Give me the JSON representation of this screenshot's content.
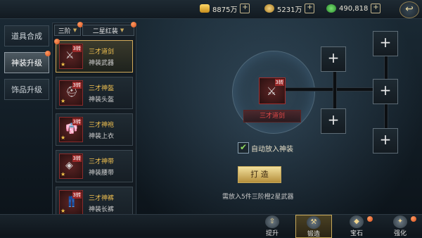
{
  "resources": {
    "gold": {
      "value": "8875万",
      "plus": "+"
    },
    "silver": {
      "value": "5231万",
      "plus": "+"
    },
    "jade": {
      "value": "490,818",
      "plus": "+"
    }
  },
  "back_button_label": "↩",
  "left_nav": [
    "道具合成",
    "神装升级",
    "饰品升级"
  ],
  "filters": {
    "tier": "三阶",
    "quality": "二星红装"
  },
  "items": [
    {
      "name": "三才道剑",
      "type": "神装武器",
      "tier": "3转",
      "glyph": "⚔"
    },
    {
      "name": "三才神盔",
      "type": "神装头盔",
      "tier": "3转",
      "glyph": "⛑"
    },
    {
      "name": "三才神袍",
      "type": "神装上衣",
      "tier": "3转",
      "glyph": "👘"
    },
    {
      "name": "三才神带",
      "type": "神装腰带",
      "tier": "3转",
      "glyph": "◈"
    },
    {
      "name": "三才神裤",
      "type": "神装长裤",
      "tier": "3转",
      "glyph": "👖"
    }
  ],
  "forge": {
    "center_item_name": "三才道剑",
    "center_item_tier": "3转",
    "auto_place_label": "自动放入神装",
    "button_label": "打 造",
    "hint": "需放入5件三阶橙2星武器"
  },
  "bottom_tabs": [
    "提升",
    "锻造",
    "宝石",
    "强化"
  ],
  "colors": {
    "accent_gold": "#c6a85a",
    "item_name": "#f0c050",
    "red_item": "#e04848"
  }
}
